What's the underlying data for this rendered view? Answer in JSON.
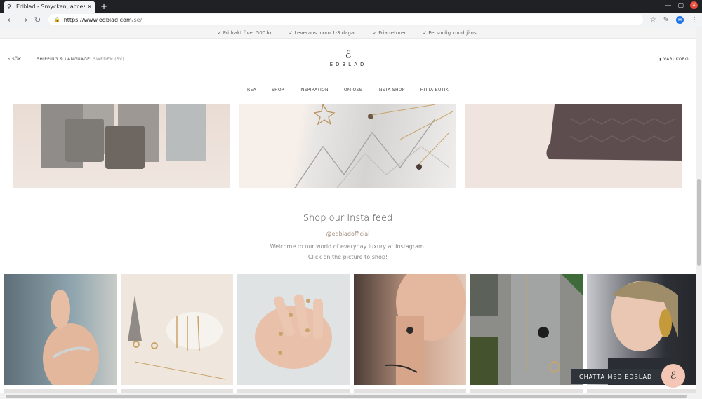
{
  "browser": {
    "tab_title": "Edblad - Smycken, accessoarer",
    "url_host": "https://www.edblad.com",
    "url_path": "/se/",
    "avatar_letter": "H"
  },
  "promo": [
    "✓ Fri frakt över 500 kr",
    "✓ Leverans inom 1-3 dagar",
    "✓ Fria returer",
    "✓ Personlig kundtjänst"
  ],
  "header": {
    "search_label": "SÖK",
    "shipping_label": "SHIPPING & LANGUAGE:",
    "shipping_value": "SWEDEN (SV)",
    "logo_mark": "ℰ",
    "logo_word": "EDBLAD",
    "cart_label": "VARUKORG"
  },
  "nav": [
    "REA",
    "SHOP",
    "INSPIRATION",
    "OM OSS",
    "INSTA SHOP",
    "HITTA BUTIK"
  ],
  "insta": {
    "title": "Shop our Insta feed",
    "handle": "@edbladofficial",
    "line1": "Welcome to our world of everyday luxury at Instagram.",
    "line2": "Click on the picture to shop!"
  },
  "chat": {
    "label": "CHATTA MED EDBLAD"
  },
  "colors": {
    "accent": "#a08676",
    "chat_bg": "#2f343a",
    "chat_bubble": "#f4c6b6"
  }
}
